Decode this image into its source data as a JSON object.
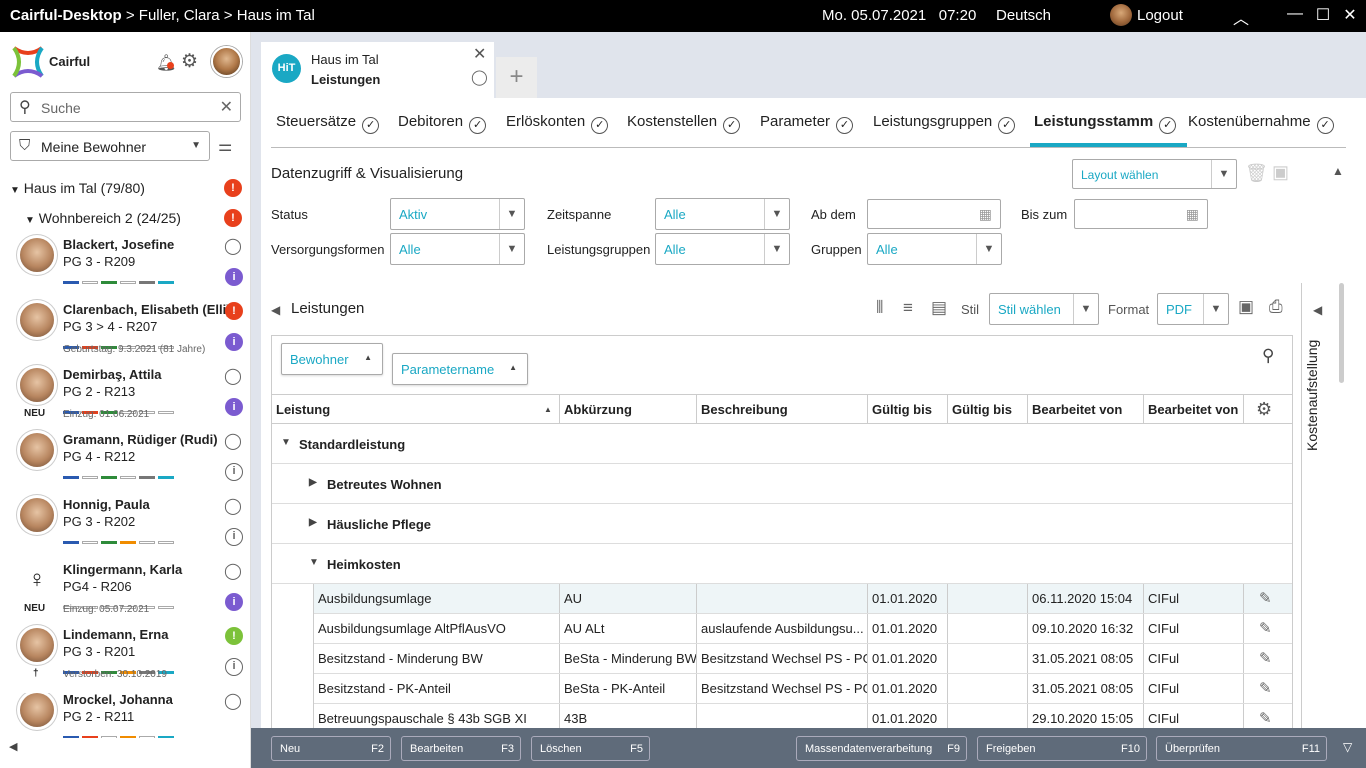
{
  "titlebar": {
    "app": "Cairful-Desktop",
    "path": " > Fuller, Clara > Haus im Tal",
    "datetime": "Mo. 05.07.2021   07:20",
    "language": "Deutsch",
    "logout": "Logout"
  },
  "sidebar": {
    "brand": "Cairful",
    "search_placeholder": "Suche",
    "filter_value": "Meine Bewohner",
    "tree_root": "Haus im Tal (79/80)",
    "tree_sub": "Wohnbereich 2 (24/25)",
    "patients": [
      {
        "name": "Blackert, Josefine",
        "info": "PG 3 - R209",
        "note": "",
        "tag": ""
      },
      {
        "name": "Clarenbach, Elisabeth (Elli)",
        "info": "PG 3 > 4 - R207",
        "note": "Geburtstag: 9.3.2021 (81 Jahre)",
        "tag": ""
      },
      {
        "name": "Demirbaş, Attila",
        "info": "PG 2 - R213",
        "note": "Einzug: 01.06.2021",
        "tag": "NEU"
      },
      {
        "name": "Gramann, Rüdiger (Rudi)",
        "info": "PG 4 - R212",
        "note": "",
        "tag": ""
      },
      {
        "name": "Honnig, Paula",
        "info": "PG 3 - R202",
        "note": "",
        "tag": ""
      },
      {
        "name": "Klingermann, Karla",
        "info": "PG4 - R206",
        "note": "Einzug: 05.07.2021",
        "tag": "NEU"
      },
      {
        "name": "Lindemann, Erna",
        "info": "PG 3 - R201",
        "note": "Verstorben: 30.10.2019",
        "tag": "†"
      },
      {
        "name": "Mrockel, Johanna",
        "info": "PG 2 - R211",
        "note": "",
        "tag": ""
      }
    ]
  },
  "doc_tab": {
    "badge": "HiT",
    "line1": "Haus im Tal",
    "line2": "Leistungen"
  },
  "tabs": [
    "Steuersätze",
    "Debitoren",
    "Erlöskonten",
    "Kostenstellen",
    "Parameter",
    "Leistungsgruppen",
    "Leistungsstamm",
    "Kostenübernahme"
  ],
  "section": {
    "title": "Datenzugriff & Visualisierung",
    "layout_placeholder": "Layout wählen"
  },
  "filters": {
    "status_label": "Status",
    "status_value": "Aktiv",
    "zeitspanne_label": "Zeitspanne",
    "zeitspanne_value": "Alle",
    "abdem_label": "Ab dem",
    "biszum_label": "Bis zum",
    "versorgung_label": "Versorgungsformen",
    "versorgung_value": "Alle",
    "lgruppen_label": "Leistungsgruppen",
    "lgruppen_value": "Alle",
    "gruppen_label": "Gruppen",
    "gruppen_value": "Alle"
  },
  "list": {
    "title": "Leistungen",
    "stil_label": "Stil",
    "stil_value": "Stil wählen",
    "format_label": "Format",
    "format_value": "PDF"
  },
  "grouping": {
    "chip1": "Bewohner",
    "chip2": "Parametername"
  },
  "columns": [
    "Leistung",
    "Abkürzung",
    "Beschreibung",
    "Gültig bis",
    "Gültig bis",
    "Bearbeitet von",
    "Bearbeitet von"
  ],
  "groups": {
    "root": "Standardleistung",
    "g1": "Betreutes Wohnen",
    "g2": "Häusliche Pflege",
    "g3": "Heimkosten"
  },
  "rows": [
    {
      "leistung": "Ausbildungsumlage",
      "abk": "AU",
      "beschr": "",
      "gueltig1": "01.01.2020",
      "gueltig2": "",
      "bearb": "06.11.2020 15:04",
      "von": "CIFul"
    },
    {
      "leistung": "Ausbildungsumlage AltPflAusVO",
      "abk": "AU ALt",
      "beschr": "auslaufende Ausbildungsu...",
      "gueltig1": "01.01.2020",
      "gueltig2": "",
      "bearb": "09.10.2020 16:32",
      "von": "CIFul"
    },
    {
      "leistung": "Besitzstand - Minderung BW",
      "abk": "BeSta - Minderung BW",
      "beschr": "Besitzstand Wechsel PS - PG",
      "gueltig1": "01.01.2020",
      "gueltig2": "",
      "bearb": "31.05.2021 08:05",
      "von": "CIFul"
    },
    {
      "leistung": "Besitzstand - PK-Anteil",
      "abk": "BeSta - PK-Anteil",
      "beschr": "Besitzstand Wechsel PS - PG",
      "gueltig1": "01.01.2020",
      "gueltig2": "",
      "bearb": "31.05.2021 08:05",
      "von": "CIFul"
    },
    {
      "leistung": "Betreuungspauschale § 43b SGB XI",
      "abk": "43B",
      "beschr": "",
      "gueltig1": "01.01.2020",
      "gueltig2": "",
      "bearb": "29.10.2020 15:05",
      "von": "CIFul"
    }
  ],
  "rail": {
    "title": "Kostenaufstellung"
  },
  "footer": [
    {
      "label": "Neu",
      "key": "F2"
    },
    {
      "label": "Bearbeiten",
      "key": "F3"
    },
    {
      "label": "Löschen",
      "key": "F5"
    },
    {
      "label": "Massendatenverarbeitung",
      "key": "F9"
    },
    {
      "label": "Freigeben",
      "key": "F10"
    },
    {
      "label": "Überprüfen",
      "key": "F11"
    }
  ]
}
